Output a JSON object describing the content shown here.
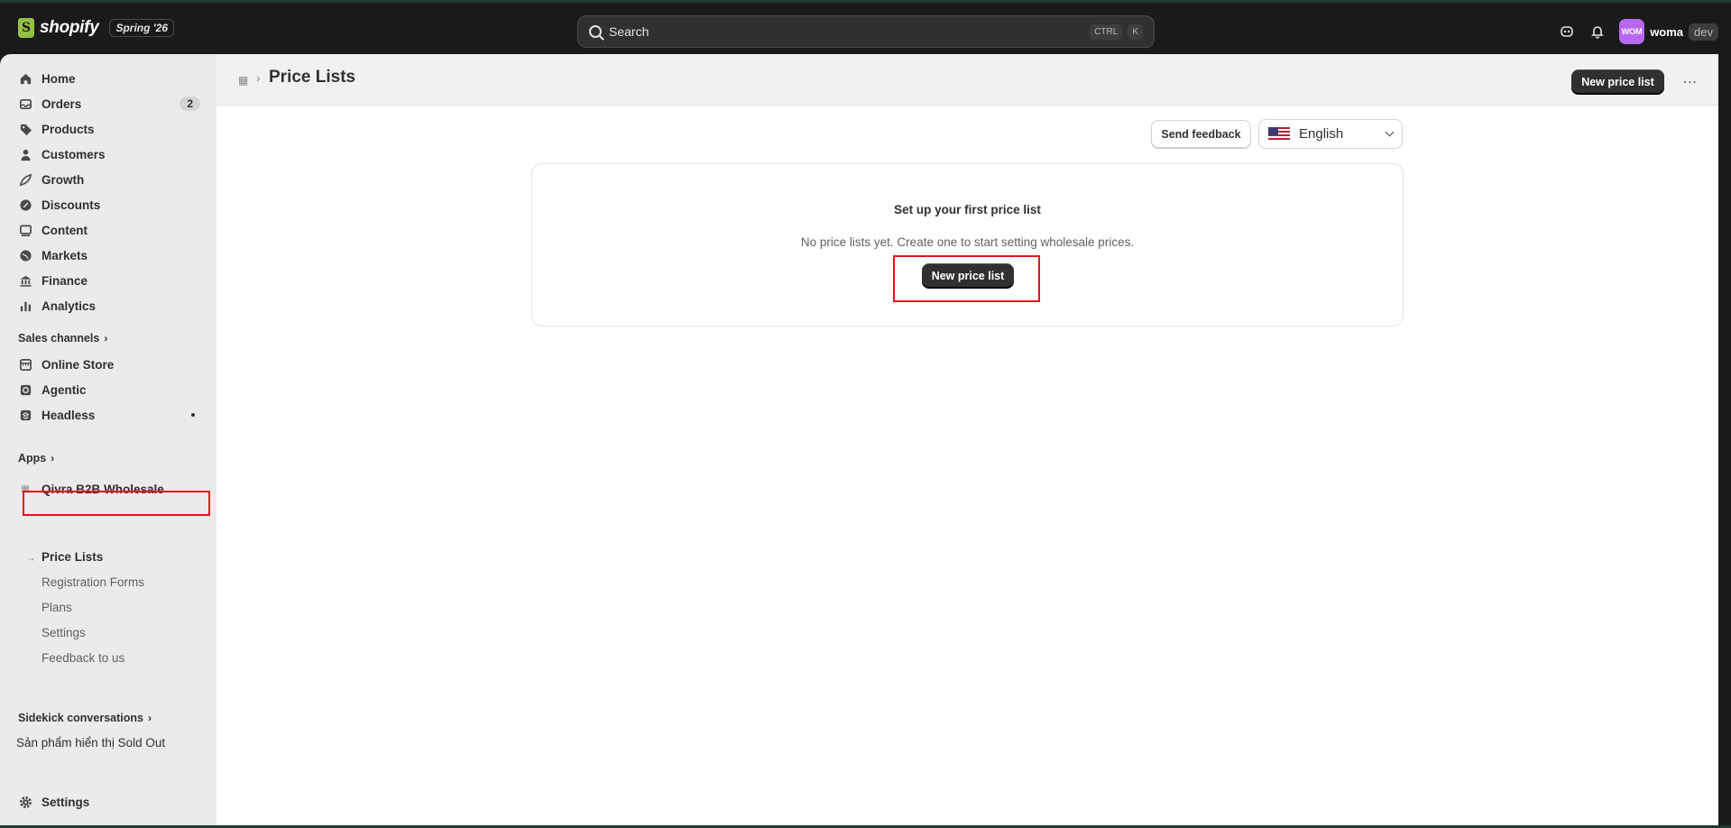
{
  "topbar": {
    "brand": "shopify",
    "season": "Spring '26",
    "search_placeholder": "Search",
    "kbd_ctrl": "CTRL",
    "kbd_k": "K",
    "avatar_initials": "WOM",
    "store_name": "woma",
    "store_badge": "dev"
  },
  "sidebar": {
    "nav": [
      {
        "label": "Home",
        "icon": "home-icon"
      },
      {
        "label": "Orders",
        "icon": "inbox-icon",
        "count": "2"
      },
      {
        "label": "Products",
        "icon": "tag-icon"
      },
      {
        "label": "Customers",
        "icon": "person-icon"
      },
      {
        "label": "Growth",
        "icon": "growth-icon"
      },
      {
        "label": "Discounts",
        "icon": "discount-icon"
      },
      {
        "label": "Content",
        "icon": "content-icon"
      },
      {
        "label": "Markets",
        "icon": "globe-icon"
      },
      {
        "label": "Finance",
        "icon": "bank-icon"
      },
      {
        "label": "Analytics",
        "icon": "bar-chart-icon"
      }
    ],
    "sales_channels_label": "Sales channels",
    "channels": [
      {
        "label": "Online Store",
        "icon": "store-icon"
      },
      {
        "label": "Agentic",
        "icon": "agentic-icon"
      },
      {
        "label": "Headless",
        "icon": "headless-icon"
      }
    ],
    "apps_label": "Apps",
    "app_name": "Qivra B2B Wholesale",
    "app_subitems": [
      "Price Lists",
      "Registration Forms",
      "Plans",
      "Settings",
      "Feedback to us"
    ],
    "sidekick_label": "Sidekick conversations",
    "sidekick_item": "Sản phẩm hiển thị Sold Out",
    "settings_label": "Settings"
  },
  "main": {
    "page_title": "Price Lists",
    "header_button": "New price list",
    "send_feedback": "Send feedback",
    "language": "English",
    "empty_state": {
      "title": "Set up your first price list",
      "description": "No price lists yet. Create one to start setting wholesale prices.",
      "button": "New price list"
    }
  }
}
